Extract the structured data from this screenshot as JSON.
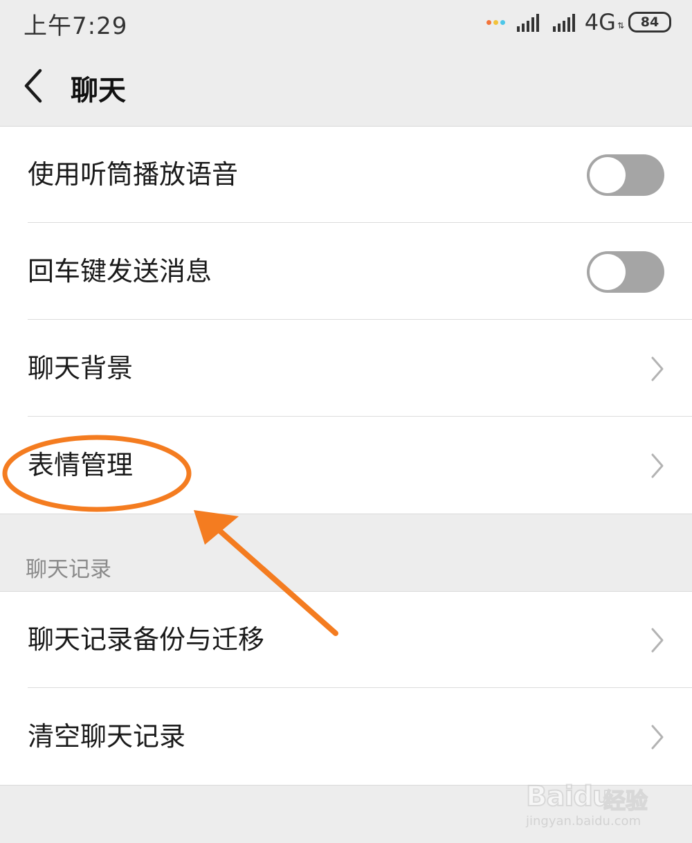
{
  "status_bar": {
    "time": "上午7:29",
    "network": "4G",
    "battery": "84",
    "notification_dot_colors": [
      "#f3743a",
      "#f2c23a",
      "#4cc6e8"
    ]
  },
  "header": {
    "title": "聊天",
    "back_icon": "chevron-left-icon"
  },
  "settings": {
    "items": [
      {
        "label": "使用听筒播放语音",
        "control": "toggle",
        "on": false
      },
      {
        "label": "回车键发送消息",
        "control": "toggle",
        "on": false
      },
      {
        "label": "聊天背景",
        "control": "chevron-right-icon"
      },
      {
        "label": "表情管理",
        "control": "chevron-right-icon",
        "highlighted": true
      }
    ]
  },
  "chat_history": {
    "section_title": "聊天记录",
    "items": [
      {
        "label": "聊天记录备份与迁移",
        "control": "chevron-right-icon"
      },
      {
        "label": "清空聊天记录",
        "control": "chevron-right-icon"
      }
    ]
  },
  "annotation": {
    "color": "#f47c20",
    "shapes": [
      "ellipse",
      "arrow"
    ]
  },
  "watermark": {
    "brand": "Baidu",
    "brand_cn": "经验",
    "url": "jingyan.baidu.com"
  },
  "colors": {
    "page_background": "#ededed",
    "card_background": "#ffffff",
    "toggle_off": "#a5a5a5",
    "secondary_text": "#8a8a8a"
  }
}
